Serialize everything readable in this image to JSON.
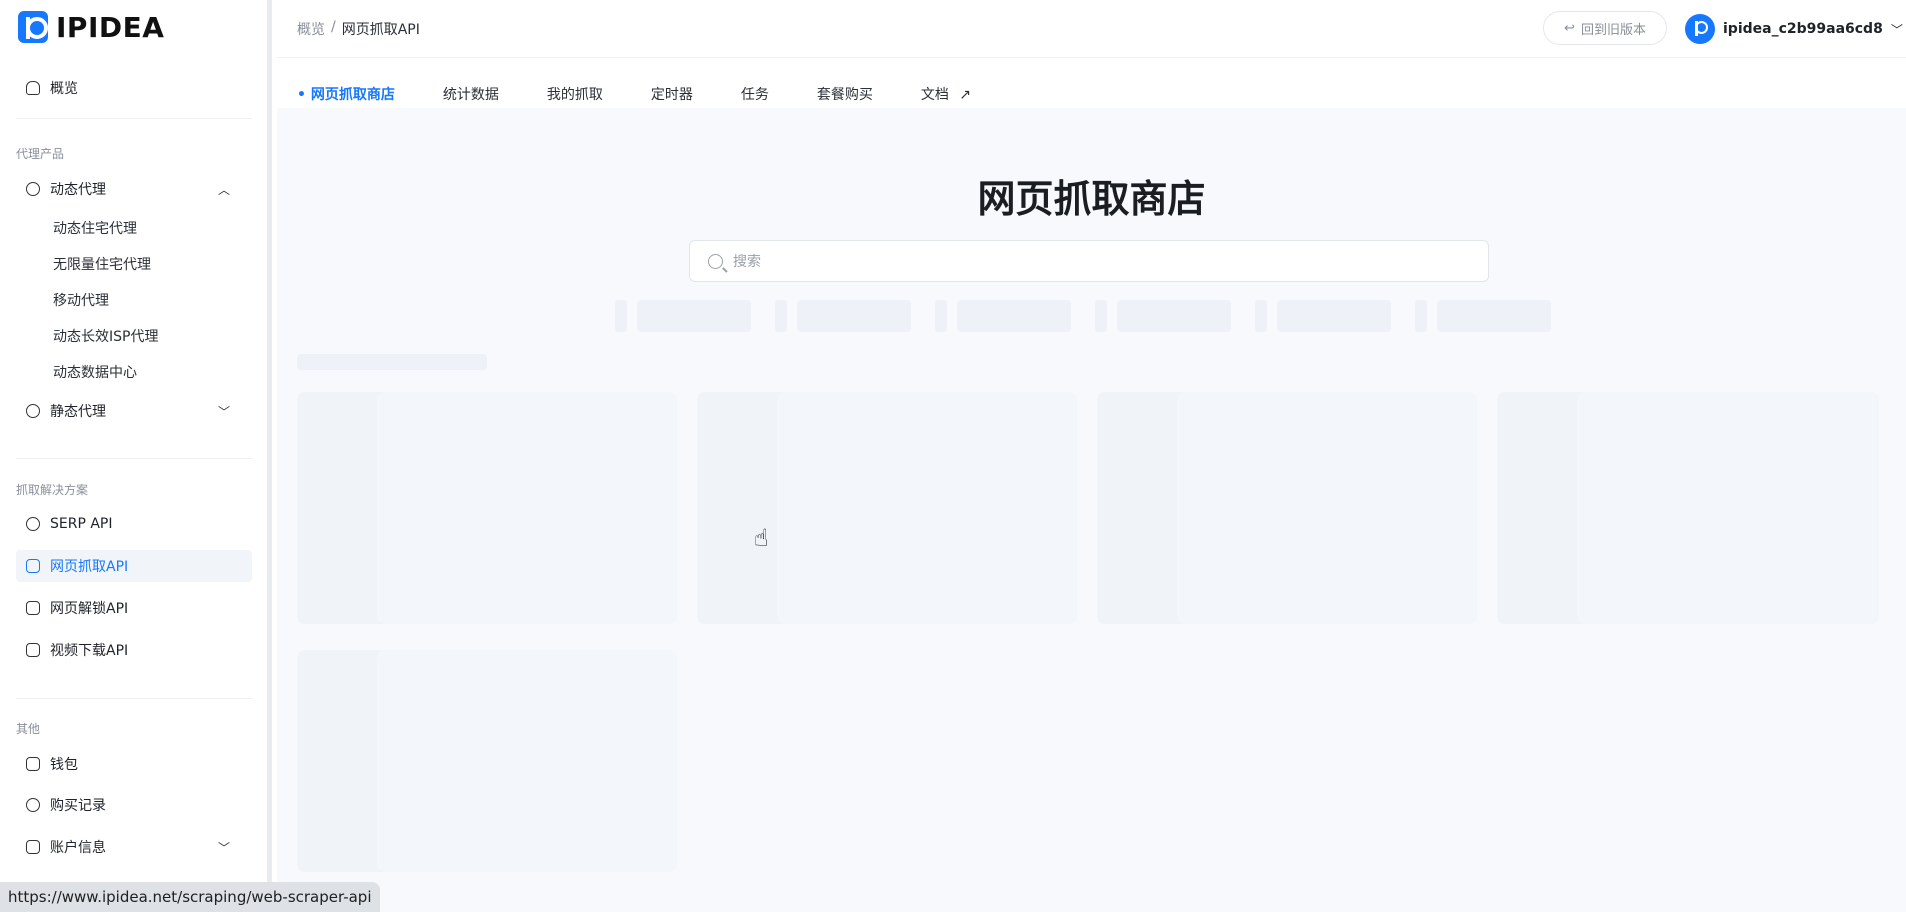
{
  "brand": {
    "name": "IPIDEA"
  },
  "sidebar": {
    "overview": "概览",
    "sections": {
      "proxy_products": "代理产品",
      "scraping_solutions": "抓取解决方案",
      "other": "其他"
    },
    "dynamic_proxy": {
      "label": "动态代理",
      "children": [
        "动态住宅代理",
        "无限量住宅代理",
        "移动代理",
        "动态长效ISP代理",
        "动态数据中心"
      ]
    },
    "static_proxy": "静态代理",
    "scraping": [
      "SERP API",
      "网页抓取API",
      "网页解锁API",
      "视频下载API"
    ],
    "active_item": "网页抓取API",
    "others": [
      "钱包",
      "购买记录",
      "账户信息"
    ]
  },
  "topbar": {
    "breadcrumb_root": "概览",
    "breadcrumb_sep": "/",
    "breadcrumb_current": "网页抓取API",
    "old_version": "回到旧版本",
    "username": "ipidea_c2b99aa6cd8"
  },
  "tabs": [
    "网页抓取商店",
    "统计数据",
    "我的抓取",
    "定时器",
    "任务",
    "套餐购买",
    "文档"
  ],
  "main": {
    "title": "网页抓取商店",
    "search_placeholder": "搜索"
  },
  "status_url": "https://www.ipidea.net/scraping/web-scraper-api",
  "colors": {
    "accent": "#1677ff",
    "sidebar_active_bg": "#f1f4f9",
    "main_bg": "#f7f9fc"
  }
}
